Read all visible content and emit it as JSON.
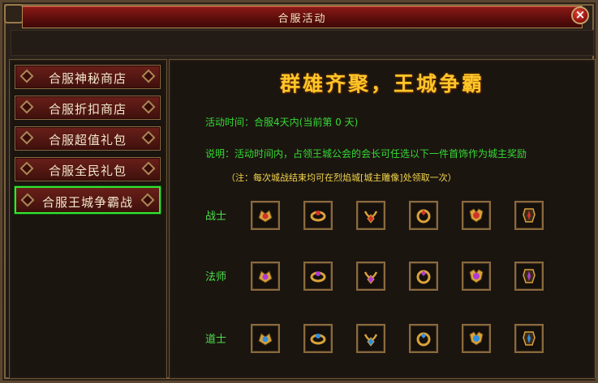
{
  "window": {
    "title": "合服活动",
    "close_icon": "close-icon"
  },
  "sidebar": {
    "items": [
      {
        "label": "合服神秘商店",
        "active": false
      },
      {
        "label": "合服折扣商店",
        "active": false
      },
      {
        "label": "合服超值礼包",
        "active": false
      },
      {
        "label": "合服全民礼包",
        "active": false
      },
      {
        "label": "合服王城争霸战",
        "active": true
      }
    ]
  },
  "main": {
    "headline": "群雄齐聚，王城争霸",
    "time_text": "活动时间：合服4天内(当前第 0 天)",
    "desc_text": "说明：活动时间内，占领王城公会的会长可任选以下一件首饰作为城主奖励",
    "note_text": "（注：每次城战结束均可在烈焰城[城主雕像]处领取一次）",
    "rows": [
      {
        "label": "战士",
        "color": "#d0332a"
      },
      {
        "label": "法师",
        "color": "#b03ad6"
      },
      {
        "label": "道士",
        "color": "#2f8fe0"
      }
    ]
  },
  "colors": {
    "accent_gold": "#ffc628",
    "green_text": "#35d935",
    "note_yellow": "#f4d64c",
    "active_border": "#33e633"
  }
}
